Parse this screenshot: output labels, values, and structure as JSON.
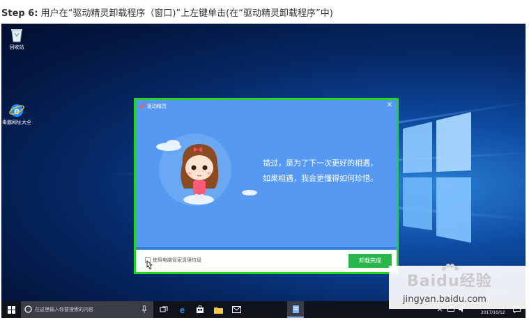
{
  "header": {
    "step_label": "Step 6:",
    "instruction": "用户在“驱动精灵卸载程序（窗口)”上左键单击(在“驱动精灵卸载程序”中)"
  },
  "desktop": {
    "icons": [
      {
        "label": "回收站",
        "icon": "recycle-bin-icon"
      },
      {
        "label": "毒霸网址大全",
        "icon": "ie-icon"
      }
    ]
  },
  "dialog": {
    "title": "驱动精灵",
    "close_glyph": "×",
    "message_line1": "错过，是为了下一次更好的相遇，",
    "message_line2": "如果相遇，我会更懂得如何珍惜。",
    "checkbox_label": "使用电脑管家清理垃圾",
    "finish_label": "卸载完成",
    "checkbox_checked": false,
    "accent_color": "#5599f2",
    "button_color": "#29b64c",
    "highlight_color": "#1fd81f"
  },
  "taskbar": {
    "search_placeholder": "在这里输入你要搜索的内容",
    "date": "2017/10/12",
    "icons": [
      "windows-start-icon",
      "search-circle-icon",
      "microphone-icon",
      "task-view-icon",
      "edge-icon",
      "store-icon",
      "file-explorer-icon",
      "mail-icon",
      "driver-genius-icon",
      "chevron-up-icon",
      "network-icon",
      "volume-icon",
      "notification-icon"
    ]
  },
  "watermark": {
    "brand": "Baidu经验",
    "site": "jingyan.baidu.com"
  }
}
